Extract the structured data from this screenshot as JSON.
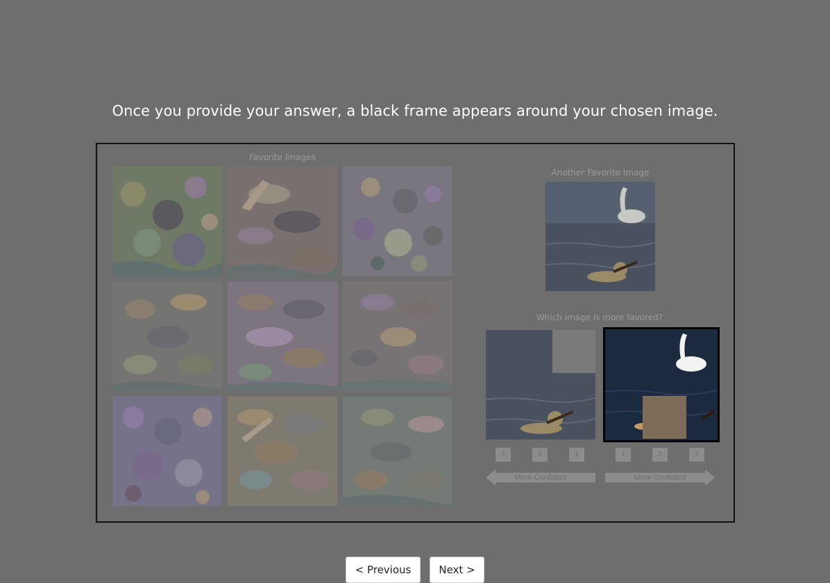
{
  "instruction": "Once you provide your answer, a black frame appears around your chosen image.",
  "favorites": {
    "label": "Favorite Images",
    "tiles": [
      {
        "tint": "#7a8a70"
      },
      {
        "tint": "#847a78"
      },
      {
        "tint": "#7e7a86"
      },
      {
        "tint": "#7a7878"
      },
      {
        "tint": "#837a82"
      },
      {
        "tint": "#7d7878"
      },
      {
        "tint": "#7b748a"
      },
      {
        "tint": "#827c72"
      },
      {
        "tint": "#7a7e78"
      }
    ]
  },
  "another_favorite": {
    "label": "Another Favorite Image"
  },
  "question": {
    "label": "Which image is more favored?"
  },
  "left_option": {
    "confidence_buttons": [
      "3",
      "2",
      "1"
    ],
    "arrow_label": "More Confident",
    "occluder_color": "#7a7a7a"
  },
  "right_option": {
    "confidence_buttons": [
      "1",
      "2",
      "3"
    ],
    "arrow_label": "More Confident",
    "occluder_color": "#7d6c58",
    "selected": true
  },
  "navigation": {
    "previous_label": "< Previous",
    "next_label": "Next >"
  }
}
